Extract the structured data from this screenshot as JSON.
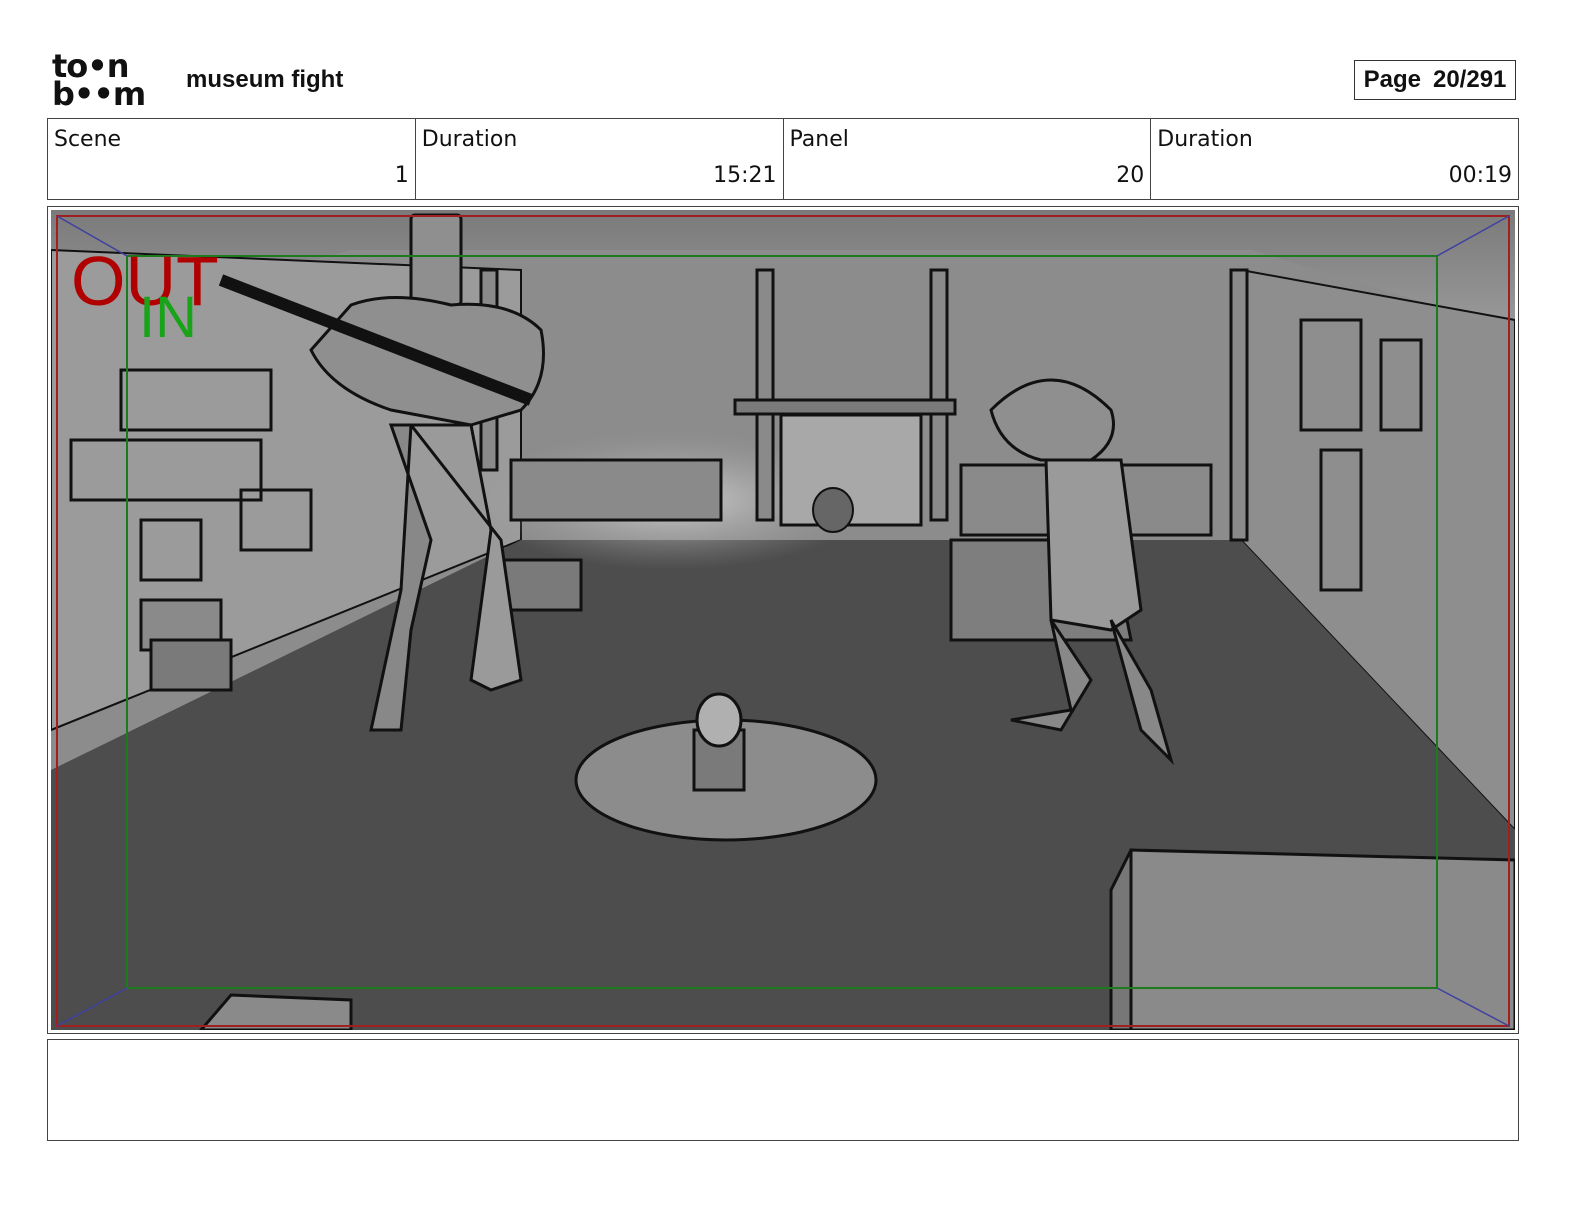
{
  "header": {
    "logo_line1": "to•n",
    "logo_line2": "b••m",
    "project_title": "museum fight",
    "page_label": "Page",
    "page_number": "20/291"
  },
  "info": [
    {
      "label": "Scene",
      "value": "1"
    },
    {
      "label": "Duration",
      "value": "15:21"
    },
    {
      "label": "Panel",
      "value": "20"
    },
    {
      "label": "Duration",
      "value": "00:19"
    }
  ],
  "panel": {
    "out_label": "OUT",
    "in_label": "IN",
    "colors": {
      "out": "#b00000",
      "in": "#19a319",
      "frame_red": "#a02020",
      "frame_green": "#1e7a1e",
      "floor": "#4d4d4d",
      "wall": "#8a8a8a"
    }
  },
  "notes": ""
}
